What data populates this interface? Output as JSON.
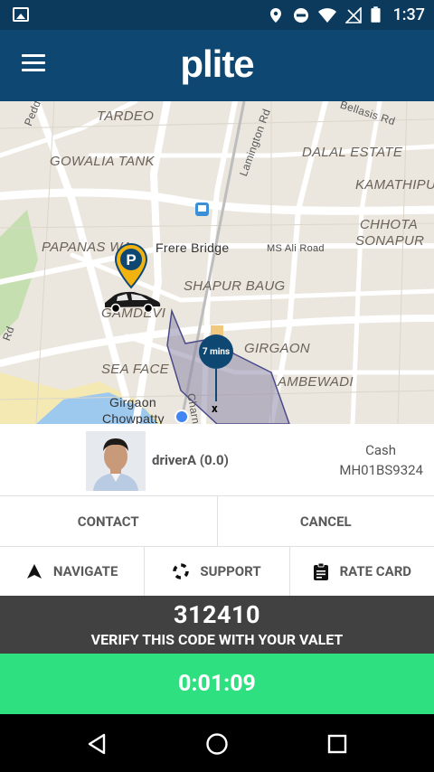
{
  "status_bar": {
    "time": "1:37",
    "icons": [
      "image-icon",
      "location-icon",
      "do-not-disturb-icon",
      "wifi-icon",
      "no-signal-icon",
      "battery-icon"
    ]
  },
  "app_bar": {
    "logo": "plite",
    "menu_icon": "hamburger-icon"
  },
  "map": {
    "labels": {
      "tardeo": "TARDEO",
      "gowalia_tank": "GOWALIA TANK",
      "dalal_estate": "DALAL ESTATE",
      "kamathipura": "KAMATHIPU",
      "chhota_sonapur_1": "CHHOTA",
      "chhota_sonapur_2": "SONAPUR",
      "papanas_wadi": "PAPANAS WA",
      "frere_bridge": "Frere Bridge",
      "ms_ali_road": "MS Ali Road",
      "shapur_baug": "SHAPUR BAUG",
      "gamdevi": "GAMDEVI",
      "girgaon": "GIRGAON",
      "sea_face": "SEA FACE",
      "ambewadi": "AMBEWADI",
      "girgaon_chowpatty_1": "Girgaon",
      "girgaon_chowpatty_2": "Chowpatty",
      "pedder_rd": "Pedder Rd",
      "bellasis_rd": "Bellasis Rd",
      "lamington_rd": "Lamington Rd",
      "charni": "Charni",
      "rd_left": "Rd"
    },
    "eta_badge": "7 mins",
    "destination_marker": "x"
  },
  "driver": {
    "name": "driverA (0.0)",
    "payment": "Cash",
    "plate": "MH01BS9324"
  },
  "actions": {
    "contact": "CONTACT",
    "cancel": "CANCEL",
    "navigate": "NAVIGATE",
    "support": "SUPPORT",
    "rate_card": "RATE CARD"
  },
  "verification": {
    "code": "312410",
    "instruction": "VERIFY THIS CODE WITH YOUR VALET"
  },
  "timer": "0:01:09",
  "colors": {
    "status_bar": "#0b3a5c",
    "app_bar": "#0e4872",
    "code_panel": "#414141",
    "timer": "#2fe081",
    "zone": "#5b5b8f"
  }
}
